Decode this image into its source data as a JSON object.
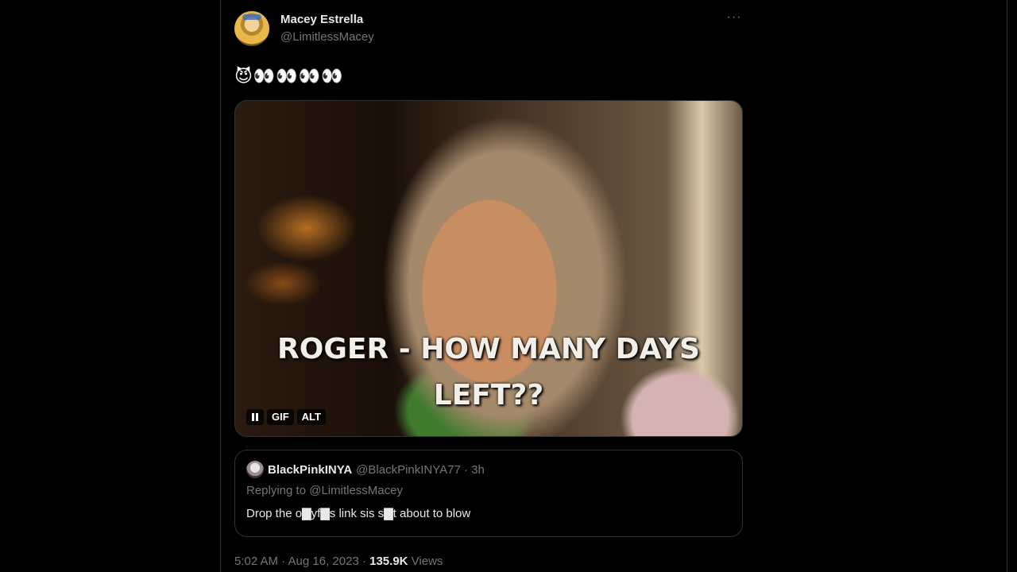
{
  "tweet": {
    "display_name": "Macey Estrella",
    "handle": "@LimitlessMacey",
    "more_icon": "···",
    "text": "😈👀👀👀👀",
    "media": {
      "caption_line1": "ROGER - HOW MANY DAYS",
      "caption_line2": "LEFT??",
      "gif_label": "GIF",
      "alt_label": "ALT"
    },
    "quote": {
      "name": "BlackPinkINYA",
      "meta": "@BlackPinkINYA77 · 3h",
      "replying_to": "Replying to @LimitlessMacey",
      "text": "Drop the o▇yf▇s link sis s▇t about to blow"
    },
    "footer": {
      "time": "5:02 AM · Aug 16, 2023 · ",
      "views_count": "135.9K",
      "views_label": " Views"
    }
  }
}
